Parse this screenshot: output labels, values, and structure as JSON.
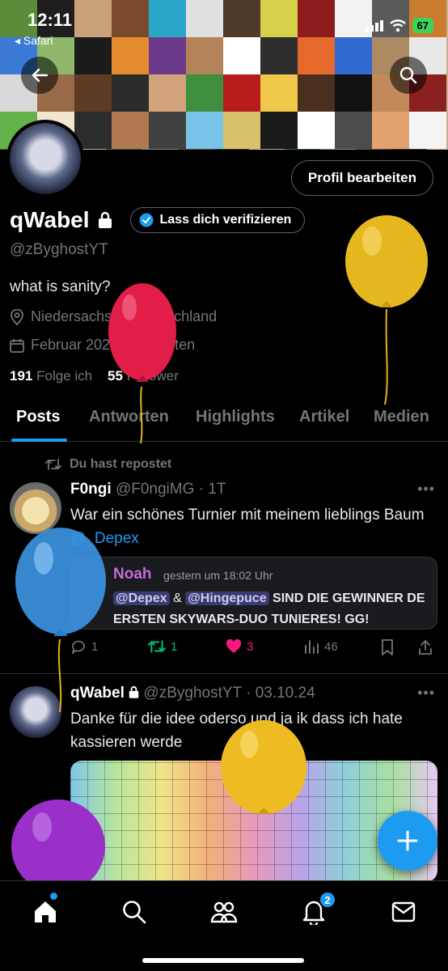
{
  "status_bar": {
    "time": "12:11",
    "back_app": "Safari",
    "battery": "67"
  },
  "header": {
    "back_icon": "arrow-left-icon",
    "search_icon": "search-icon"
  },
  "profile": {
    "edit_button": "Profil bearbeiten",
    "display_name": "qWabel",
    "verify_label": "Lass dich verifizieren",
    "handle": "@zByghostYT",
    "bio": "what is sanity?",
    "location": "Niedersachsen, Deutschland",
    "joined": "Februar 2022 beigetreten",
    "following_count": "191",
    "following_label": "Folge ich",
    "followers_count": "55",
    "followers_label": "Follower"
  },
  "tabs": [
    "Posts",
    "Antworten",
    "Highlights",
    "Artikel",
    "Medien"
  ],
  "feed": {
    "repost_label": "Du hast repostet",
    "post1": {
      "name": "F0ngi",
      "handle": "@F0ngiMG",
      "time": "1T",
      "text_prefix": "War ein schönes Turnier mit meinem lieblings Baum ",
      "mention": "@_Depex",
      "embed": {
        "name": "Noah",
        "time": "gestern um 18:02 Uhr",
        "mention1": "@Depex",
        "amp": "&",
        "mention2": "@Hingepuce",
        "line1_rest": "SIND DIE GEWINNER DE",
        "line2": "ERSTEN SKYWARS-DUO TUNIERES! GG!"
      },
      "replies": "1",
      "reposts": "1",
      "likes": "3",
      "views": "46"
    },
    "post2": {
      "name": "qWabel",
      "handle": "@zByghostYT",
      "date": "03.10.24",
      "text": "Danke für die idee oderso und ja ik dass ich hate kassieren werde"
    }
  },
  "nav": {
    "notifications_badge": "2"
  },
  "colors": {
    "accent": "#1d9bf0",
    "like": "#f91880",
    "repost": "#00ba7c"
  }
}
